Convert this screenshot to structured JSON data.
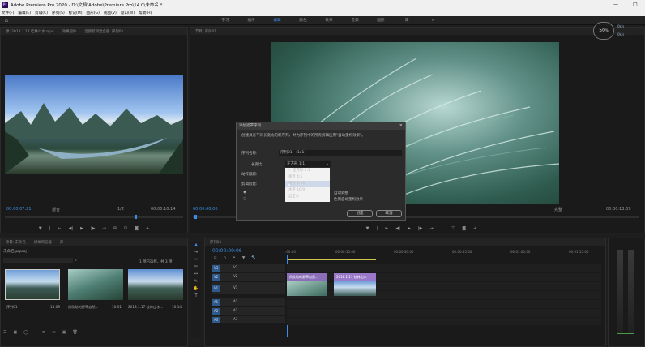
{
  "app": {
    "title": "Adobe Premiere Pro 2020 - D:\\文档\\Adobe\\Premiere Pro\\14.0\\未命名 *",
    "logo": "Pr",
    "minimize": "—",
    "maximize": "□"
  },
  "menu": [
    "文件(F)",
    "编辑(E)",
    "剪辑(C)",
    "序列(S)",
    "标记(M)",
    "图形(G)",
    "视图(V)",
    "窗口(W)",
    "帮助(H)"
  ],
  "workspaces": [
    {
      "label": "学习",
      "active": false
    },
    {
      "label": "组件",
      "active": false
    },
    {
      "label": "编辑",
      "active": true
    },
    {
      "label": "颜色",
      "active": false
    },
    {
      "label": "效果",
      "active": false
    },
    {
      "label": "音频",
      "active": false
    },
    {
      "label": "图形",
      "active": false
    },
    {
      "label": "库",
      "active": false
    },
    {
      "label": "»",
      "active": false
    }
  ],
  "badge": {
    "value": "50",
    "unit": "%",
    "in": "0k/s",
    "out": "0k/s"
  },
  "source_panel": {
    "tabs": [
      "源: 2018.1.17 桂林山水.mp4",
      "效果控件",
      "音频剪辑混合器: 序列01"
    ],
    "timecode_left": "00:00:07:21",
    "timecode_right": "00:00:10:14",
    "fit": "适合",
    "scale": "1/2"
  },
  "program_panel": {
    "tabs": [
      "节目: 序列01"
    ],
    "timecode_left": "00:00:00:06",
    "timecode_right": "00:00:13:09",
    "fit": "适合",
    "scale": "完整"
  },
  "dialog": {
    "title": "添加遮罩序列",
    "description": "创建具有不同长宽比的新序列，并为序列中的所有剪辑应用\"自动重构效果\"。",
    "name_label": "序列名称:",
    "name_value": "序列01 - (1x1)",
    "aspect_label": "长宽比:",
    "aspect_value": "正方形 1:1",
    "motion_label": "动作跟踪:",
    "clip_label": "剪辑嵌套:",
    "option1": "自动调整",
    "option2": "达到自动重构效果",
    "menu_items": [
      "正方形 1:1",
      "垂直 4:5",
      "垂直 9:16",
      "水平 16:9",
      "自定义"
    ],
    "ok": "创建",
    "cancel": "取消"
  },
  "project_panel": {
    "tabs": [
      "项目: 未命名",
      "媒体浏览器",
      "库"
    ],
    "file": "未命名.prproj",
    "count": "1 项已选择，共 3 项",
    "thumbs": [
      {
        "name": "序列01",
        "duration": "13:09"
      },
      {
        "name": "风吹动的野草自然...",
        "duration": "10:01"
      },
      {
        "name": "2018.1.17 桂林山水...",
        "duration": "10:14"
      }
    ]
  },
  "timeline": {
    "tab": "序列01",
    "timecode": "00:00:00:06",
    "ruler": [
      ":00:00",
      "00:00:15:00",
      "00:00:30:00",
      "00:00:45:00",
      "00:01:00:00",
      "00:01:15:00"
    ],
    "video_tracks": [
      "V3",
      "V2",
      "V1"
    ],
    "audio_tracks": [
      "A1",
      "A2",
      "A3"
    ],
    "clips": [
      {
        "label": "风吹动的野草自然...",
        "color": "#8a6fb8"
      },
      {
        "label": "2018.1.17 桂林山水",
        "color": "#9a78c9"
      }
    ]
  },
  "colors": {
    "accent": "#3a8ee6",
    "clip": "#8a6fb8"
  }
}
